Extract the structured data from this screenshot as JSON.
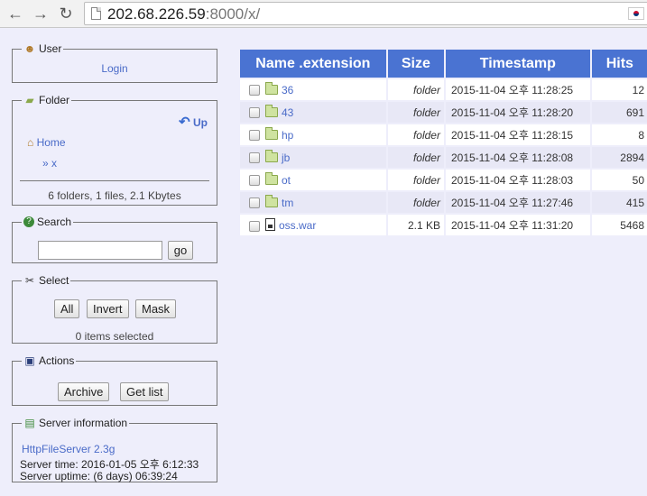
{
  "browser": {
    "url_host": "202.68.226.59",
    "url_rest": ":8000/x/"
  },
  "user_panel": {
    "legend": "User",
    "login_label": "Login"
  },
  "folder_panel": {
    "legend": "Folder",
    "up_label": "Up",
    "home_label": "Home",
    "current_label": "» x",
    "summary": "6 folders, 1 files, 2.1 Kbytes"
  },
  "search_panel": {
    "legend": "Search",
    "value": "",
    "go_label": "go"
  },
  "select_panel": {
    "legend": "Select",
    "all_label": "All",
    "invert_label": "Invert",
    "mask_label": "Mask",
    "status": "0 items selected"
  },
  "actions_panel": {
    "legend": "Actions",
    "archive_label": "Archive",
    "getlist_label": "Get list"
  },
  "server_panel": {
    "legend": "Server information",
    "software": "HttpFileServer 2.3g",
    "server_time": "Server time: 2016-01-05 오후 6:12:33",
    "server_uptime": "Server uptime: (6 days) 06:39:24"
  },
  "table": {
    "headers": [
      "Name .extension",
      "Size",
      "Timestamp",
      "Hits"
    ],
    "rows": [
      {
        "name": "36",
        "kind": "folder",
        "size": "folder",
        "timestamp": "2015-11-04 오후 11:28:25",
        "hits": "12"
      },
      {
        "name": "43",
        "kind": "folder",
        "size": "folder",
        "timestamp": "2015-11-04 오후 11:28:20",
        "hits": "691"
      },
      {
        "name": "hp",
        "kind": "folder",
        "size": "folder",
        "timestamp": "2015-11-04 오후 11:28:15",
        "hits": "8"
      },
      {
        "name": "jb",
        "kind": "folder",
        "size": "folder",
        "timestamp": "2015-11-04 오후 11:28:08",
        "hits": "2894"
      },
      {
        "name": "ot",
        "kind": "folder",
        "size": "folder",
        "timestamp": "2015-11-04 오후 11:28:03",
        "hits": "50"
      },
      {
        "name": "tm",
        "kind": "folder",
        "size": "folder",
        "timestamp": "2015-11-04 오후 11:27:46",
        "hits": "415"
      },
      {
        "name": "oss.war",
        "kind": "file",
        "size": "2.1 KB",
        "timestamp": "2015-11-04 오후 11:31:20",
        "hits": "5468"
      }
    ]
  },
  "colors": {
    "header_blue": "#4a73d2",
    "link_blue": "#4a6bc8",
    "page_bg": "#eeeefb"
  }
}
